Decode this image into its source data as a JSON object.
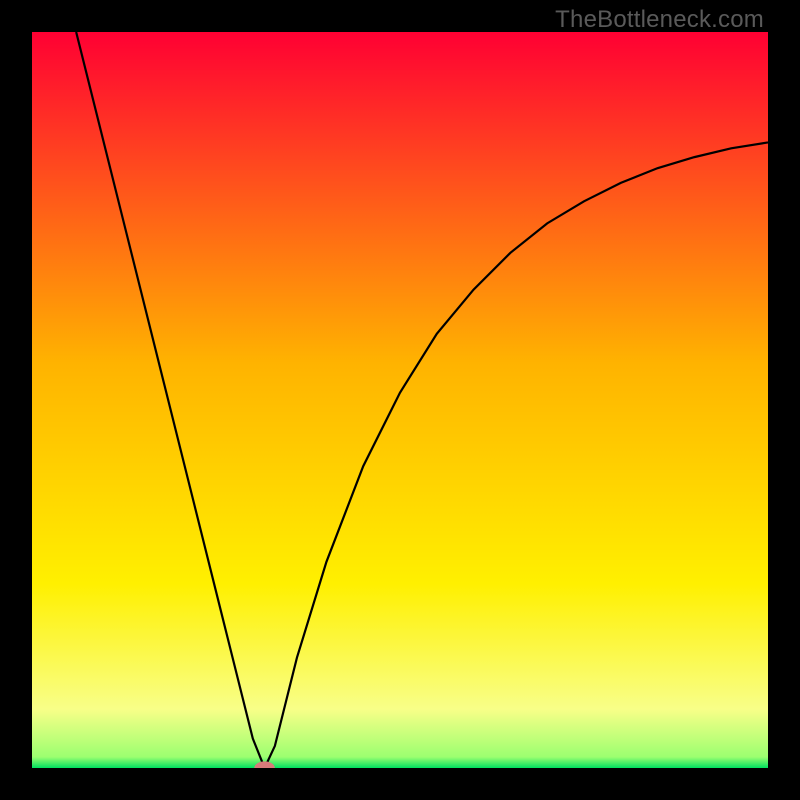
{
  "watermark": "TheBottleneck.com",
  "chart_data": {
    "type": "line",
    "title": "",
    "xlabel": "",
    "ylabel": "",
    "xlim": [
      0,
      100
    ],
    "ylim": [
      0,
      100
    ],
    "grid": false,
    "background_gradient": [
      {
        "stop": 0.0,
        "color": "#ff0033"
      },
      {
        "stop": 0.45,
        "color": "#ffb300"
      },
      {
        "stop": 0.75,
        "color": "#fff000"
      },
      {
        "stop": 0.92,
        "color": "#f8ff88"
      },
      {
        "stop": 0.985,
        "color": "#9cff70"
      },
      {
        "stop": 1.0,
        "color": "#00e060"
      }
    ],
    "series": [
      {
        "name": "curve",
        "color": "#000000",
        "data": [
          {
            "x": 6,
            "y": 100
          },
          {
            "x": 10,
            "y": 84
          },
          {
            "x": 14,
            "y": 68
          },
          {
            "x": 18,
            "y": 52
          },
          {
            "x": 22,
            "y": 36
          },
          {
            "x": 26,
            "y": 20
          },
          {
            "x": 30,
            "y": 4
          },
          {
            "x": 31.6,
            "y": 0
          },
          {
            "x": 33,
            "y": 3
          },
          {
            "x": 36,
            "y": 15
          },
          {
            "x": 40,
            "y": 28
          },
          {
            "x": 45,
            "y": 41
          },
          {
            "x": 50,
            "y": 51
          },
          {
            "x": 55,
            "y": 59
          },
          {
            "x": 60,
            "y": 65
          },
          {
            "x": 65,
            "y": 70
          },
          {
            "x": 70,
            "y": 74
          },
          {
            "x": 75,
            "y": 77
          },
          {
            "x": 80,
            "y": 79.5
          },
          {
            "x": 85,
            "y": 81.5
          },
          {
            "x": 90,
            "y": 83
          },
          {
            "x": 95,
            "y": 84.2
          },
          {
            "x": 100,
            "y": 85
          }
        ]
      }
    ],
    "marker": {
      "x": 31.6,
      "y": 0,
      "rx": 1.4,
      "ry": 0.9,
      "color": "#d87a7a"
    }
  }
}
